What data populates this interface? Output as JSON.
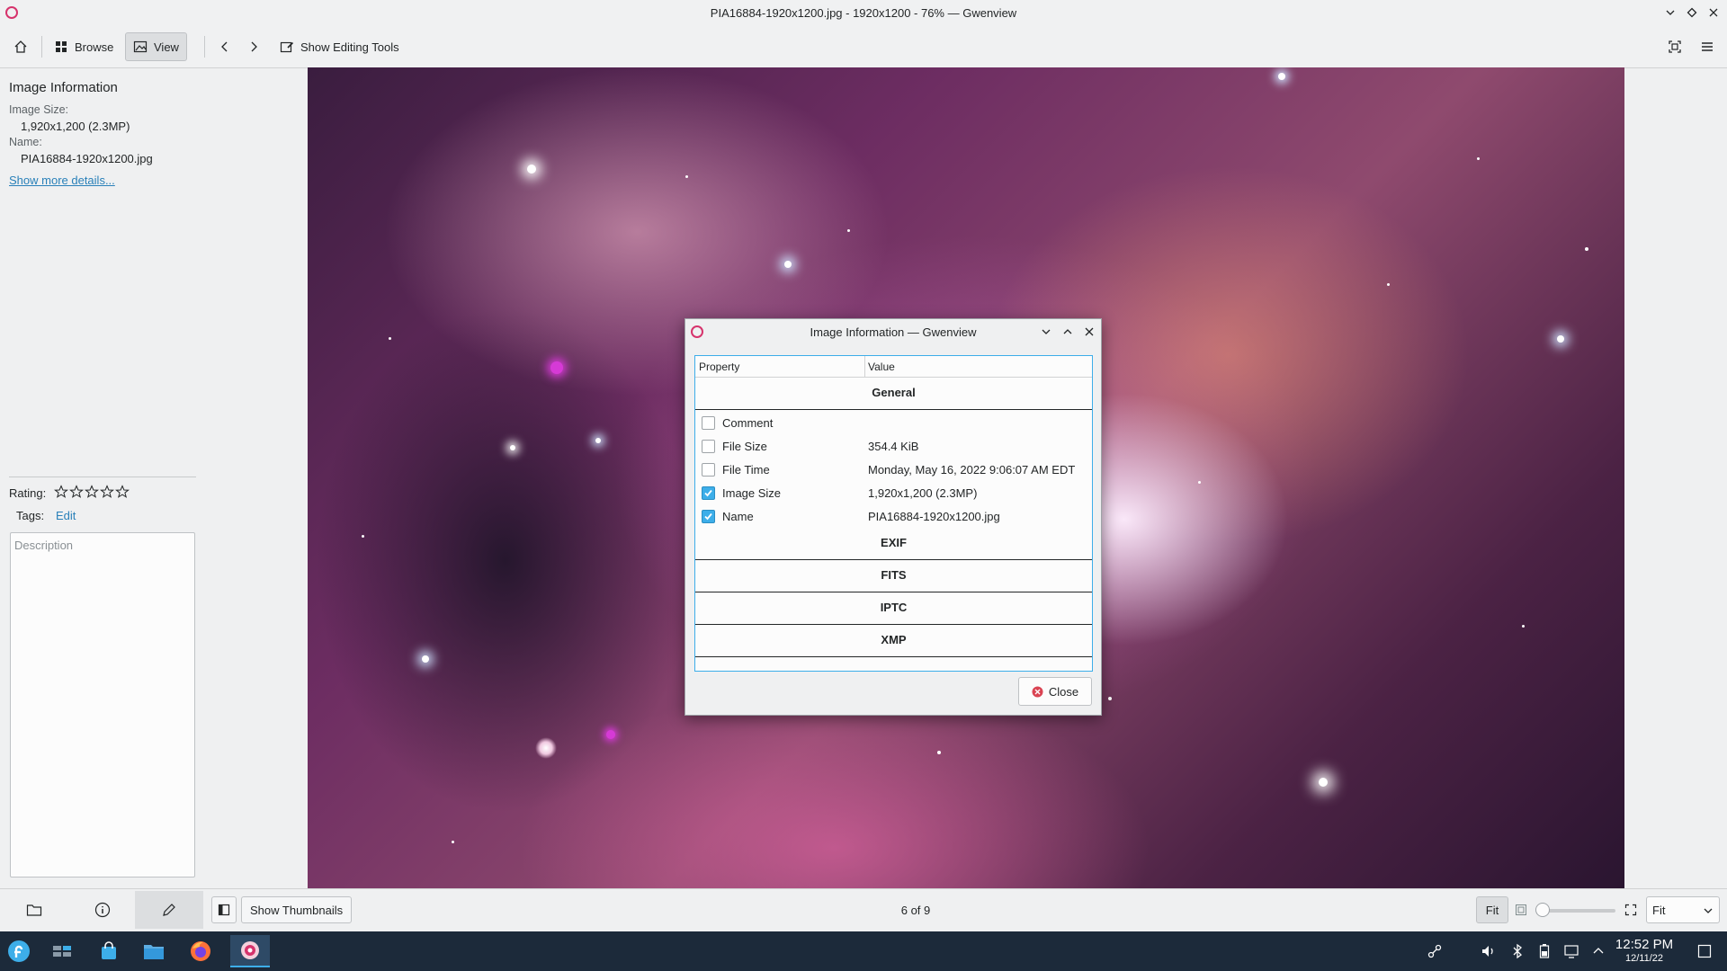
{
  "window": {
    "title": "PIA16884-1920x1200.jpg - 1920x1200 - 76% — Gwenview"
  },
  "toolbar": {
    "browse_label": "Browse",
    "view_label": "View",
    "editing_tools_label": "Show Editing Tools"
  },
  "sidebar": {
    "section_title": "Image Information",
    "image_size_label": "Image Size:",
    "image_size_value": "1,920x1,200 (2.3MP)",
    "name_label": "Name:",
    "name_value": "PIA16884-1920x1200.jpg",
    "show_more_link": "Show more details...",
    "rating_label": "Rating:",
    "rating_value": 0,
    "rating_max": 5,
    "tags_label": "Tags:",
    "tags_edit_link": "Edit",
    "description_placeholder": "Description"
  },
  "dialog": {
    "title": "Image Information — Gwenview",
    "columns": {
      "property": "Property",
      "value": "Value"
    },
    "groups": {
      "general": "General",
      "exif": "EXIF",
      "fits": "FITS",
      "iptc": "IPTC",
      "xmp": "XMP"
    },
    "rows": [
      {
        "property": "Comment",
        "value": "",
        "checked": false
      },
      {
        "property": "File Size",
        "value": "354.4 KiB",
        "checked": false
      },
      {
        "property": "File Time",
        "value": "Monday, May 16, 2022 9:06:07 AM EDT",
        "checked": false
      },
      {
        "property": "Image Size",
        "value": "1,920x1,200 (2.3MP)",
        "checked": true
      },
      {
        "property": "Name",
        "value": "PIA16884-1920x1200.jpg",
        "checked": true
      }
    ],
    "close_label": "Close"
  },
  "bottombar": {
    "show_thumbnails_label": "Show Thumbnails",
    "counter": "6 of 9",
    "fit_label": "Fit",
    "zoom_select_value": "Fit"
  },
  "taskbar": {
    "time": "12:52 PM",
    "date": "12/11/22"
  },
  "colors": {
    "accent": "#3daee9",
    "link": "#2980b9",
    "app_brand": "#d6336c",
    "taskbar_bg": "#1c2a3a"
  }
}
